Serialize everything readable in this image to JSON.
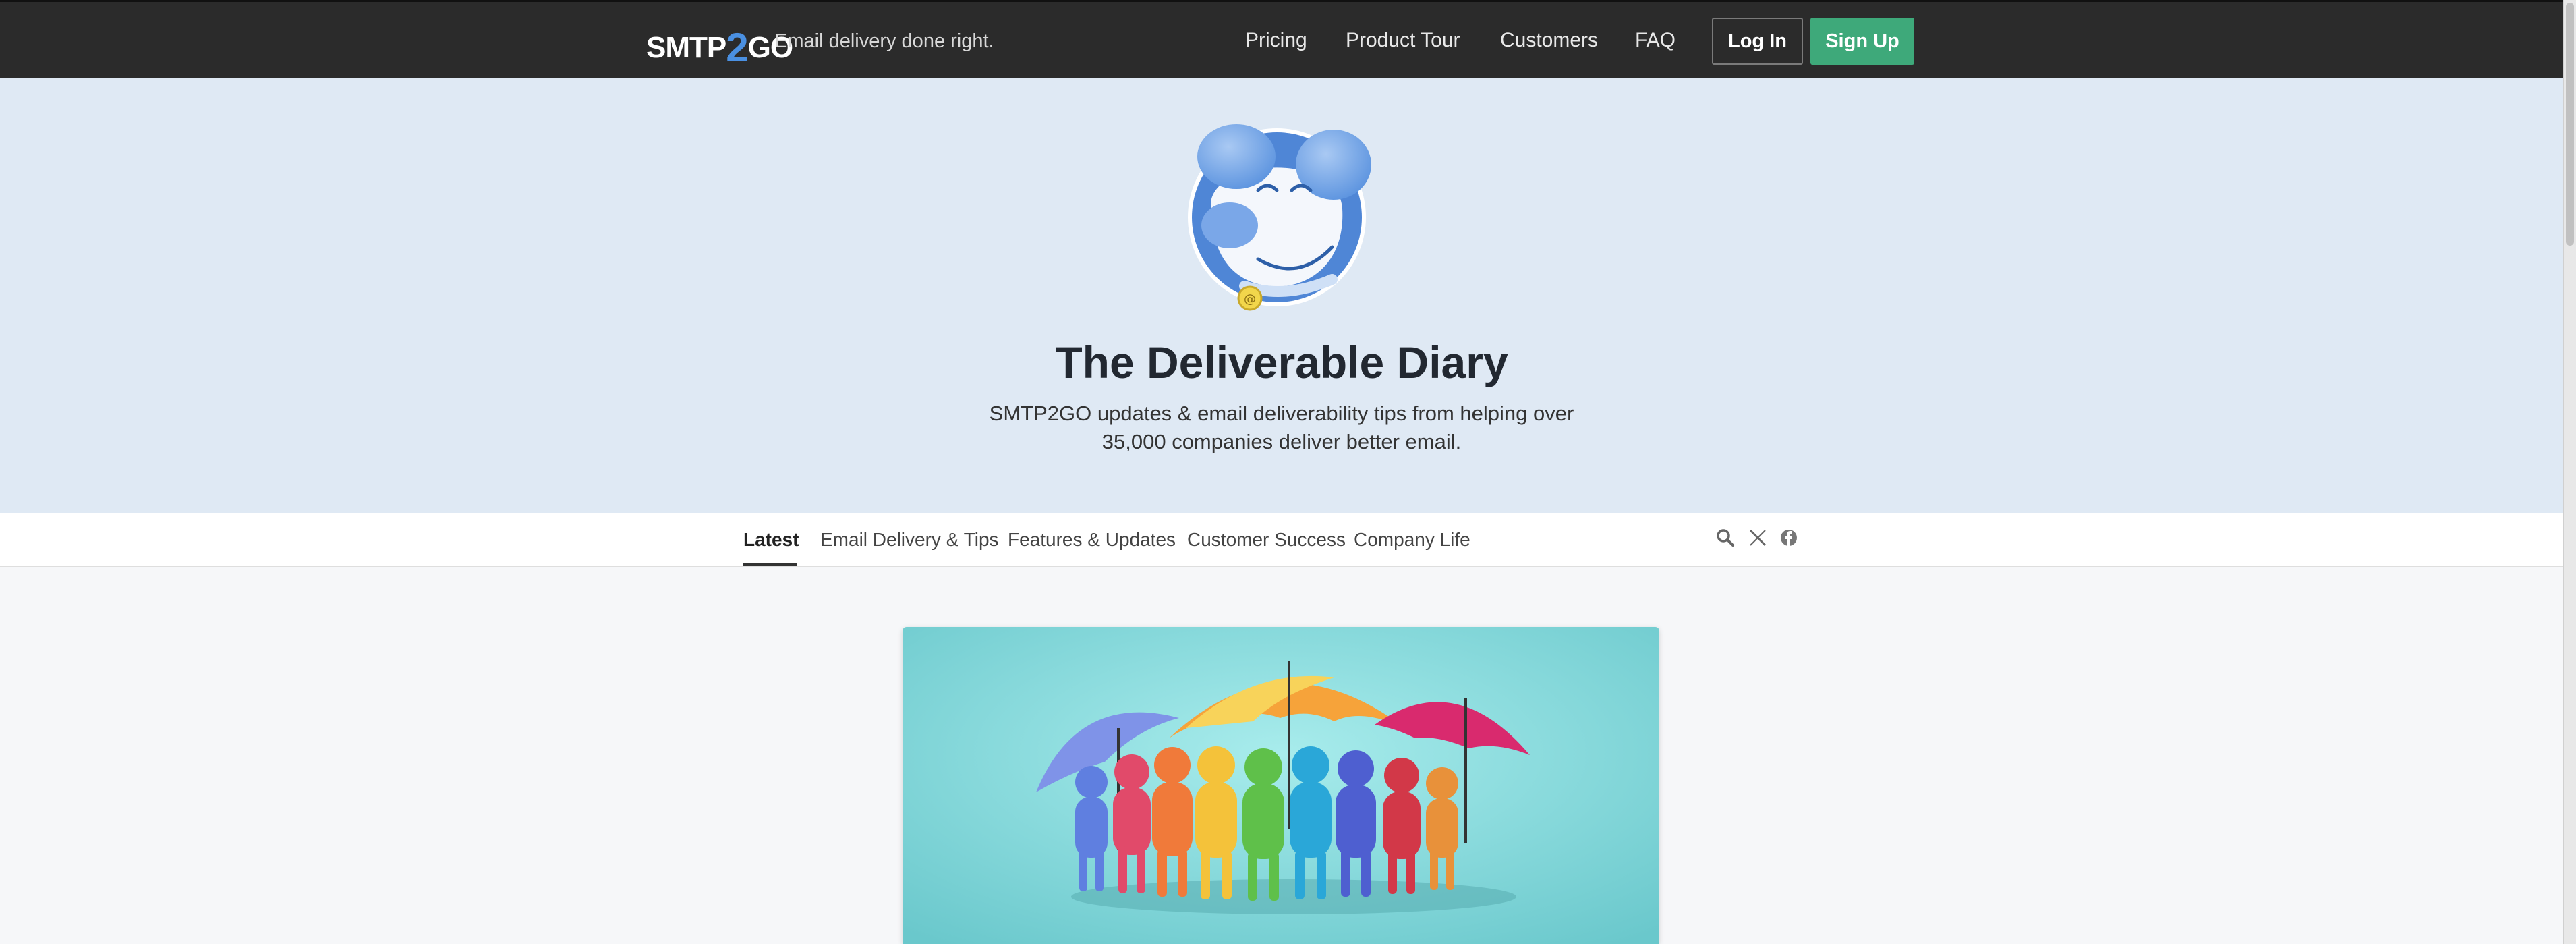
{
  "header": {
    "logo_text_pre": "SMTP",
    "logo_text_two": "2",
    "logo_text_post": "GO",
    "tagline": "Email delivery done right.",
    "nav": [
      "Pricing",
      "Product Tour",
      "Customers",
      "FAQ"
    ],
    "login_label": "Log In",
    "signup_label": "Sign Up"
  },
  "hero": {
    "title": "The Deliverable Diary",
    "subtitle": "SMTP2GO updates & email deliverability tips from helping over 35,000 companies deliver better email."
  },
  "tabs": {
    "items": [
      "Latest",
      "Email Delivery & Tips",
      "Features & Updates",
      "Customer Success",
      "Company Life"
    ],
    "active": "Latest",
    "icons": [
      "search-icon",
      "x-twitter-icon",
      "facebook-icon"
    ]
  },
  "colors": {
    "topbar": "#2b2b2b",
    "hero_bg": "#dfe9f4",
    "signup_green": "#3ea97a",
    "logo_blue": "#4a90e2"
  }
}
